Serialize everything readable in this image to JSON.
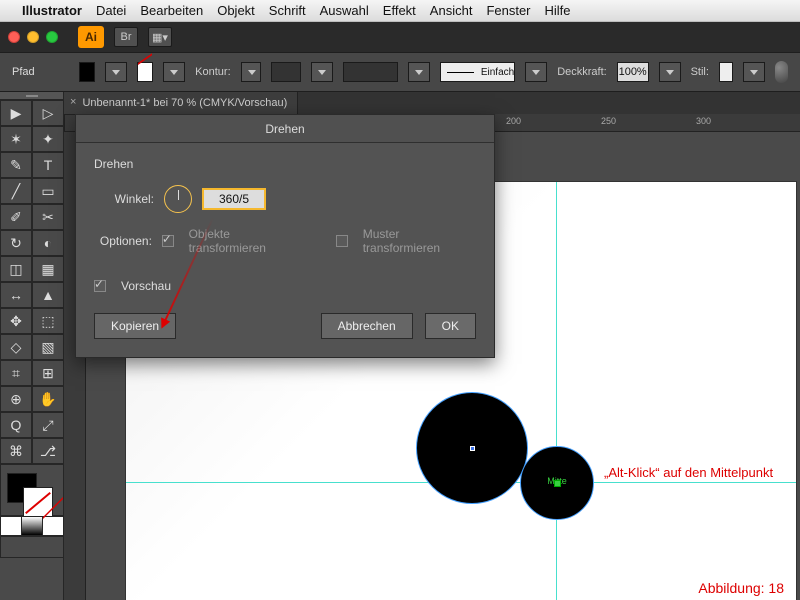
{
  "mac_menu": {
    "apple_icon": "",
    "app": "Illustrator",
    "items": [
      "Datei",
      "Bearbeiten",
      "Objekt",
      "Schrift",
      "Auswahl",
      "Effekt",
      "Ansicht",
      "Fenster",
      "Hilfe"
    ]
  },
  "titlebar": {
    "badge": "Ai",
    "btn1": "Br",
    "btn2": "▦▾"
  },
  "controlbar": {
    "object_type": "Pfad",
    "kontur": "Kontur:",
    "deckkraft_label": "Deckkraft:",
    "deckkraft_value": "100%",
    "stil_label": "Stil:",
    "brush_label": "Einfach"
  },
  "doc_tab": {
    "title": "Unbenannt-1* bei 70 % (CMYK/Vorschau)"
  },
  "ruler_marks": {
    "r1": "200",
    "r2": "250",
    "r3": "300"
  },
  "dialog": {
    "title": "Drehen",
    "group": "Drehen",
    "angle_label": "Winkel:",
    "angle_value": "360/5",
    "options_label": "Optionen:",
    "opt_transform": "Objekte transformieren",
    "opt_pattern": "Muster transformieren",
    "preview": "Vorschau",
    "copy": "Kopieren",
    "cancel": "Abbrechen",
    "ok": "OK"
  },
  "canvas": {
    "mitte": "Mitte",
    "annotation": "„Alt-Klick“ auf den Mittelpunkt",
    "caption": "Abbildung: 18"
  },
  "tool_icons": [
    "▶",
    "▷",
    "✶",
    "✦",
    "✎",
    "T",
    "╱",
    "▭",
    "✐",
    "✂",
    "↻",
    "◐",
    "◫",
    "▦",
    "↔",
    "▲",
    "✥",
    "⬚",
    "◇",
    "▧",
    "⌗",
    "⊞",
    "⊕",
    "✋",
    "Q",
    "⤢",
    "⌘",
    "⎇"
  ]
}
